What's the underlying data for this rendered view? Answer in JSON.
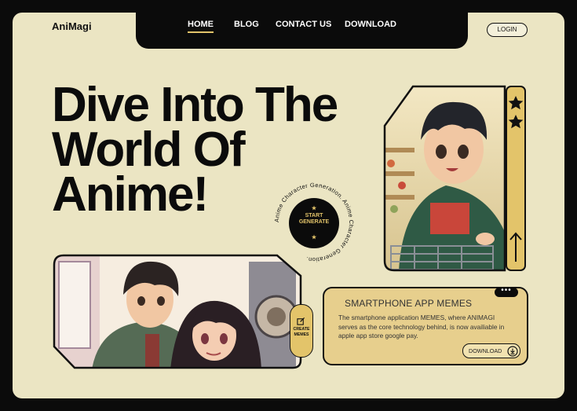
{
  "brand": {
    "logo": "AniMagi"
  },
  "nav": {
    "items": [
      {
        "label": "HOME",
        "active": true
      },
      {
        "label": "BLOG",
        "active": false
      },
      {
        "label": "CONTACT US",
        "active": false
      },
      {
        "label": "DOWNLOAD",
        "active": false
      }
    ],
    "login_label": "LOGIN"
  },
  "hero": {
    "headline_lines": [
      "Dive Into The",
      "World Of",
      "Anime!"
    ]
  },
  "badge": {
    "circular_text": "Anime Character Generation. Anime Character Generation.",
    "line1": "START",
    "line2": "GENERATE",
    "star_icon": "★"
  },
  "memes_card": {
    "title": "SMARTPHONE APP MEMES",
    "body": "The smartphone application MEMES, where ANIMAGI serves as the core technology behind, is now availiable in apple app store google pay.",
    "download_label": "DOWNLOAD",
    "dots": "•••"
  },
  "create_memes": {
    "line1": "CREATE",
    "line2": "MEMES"
  },
  "side_rail": {
    "icons": [
      "star-icon",
      "star-icon",
      "arrow-up-icon"
    ]
  },
  "colors": {
    "background": "#0b0b0b",
    "cream": "#ebe5c3",
    "accent_gold": "#e3c46a",
    "card_gold": "#e7cf8d",
    "ink": "#0b0b0b"
  }
}
